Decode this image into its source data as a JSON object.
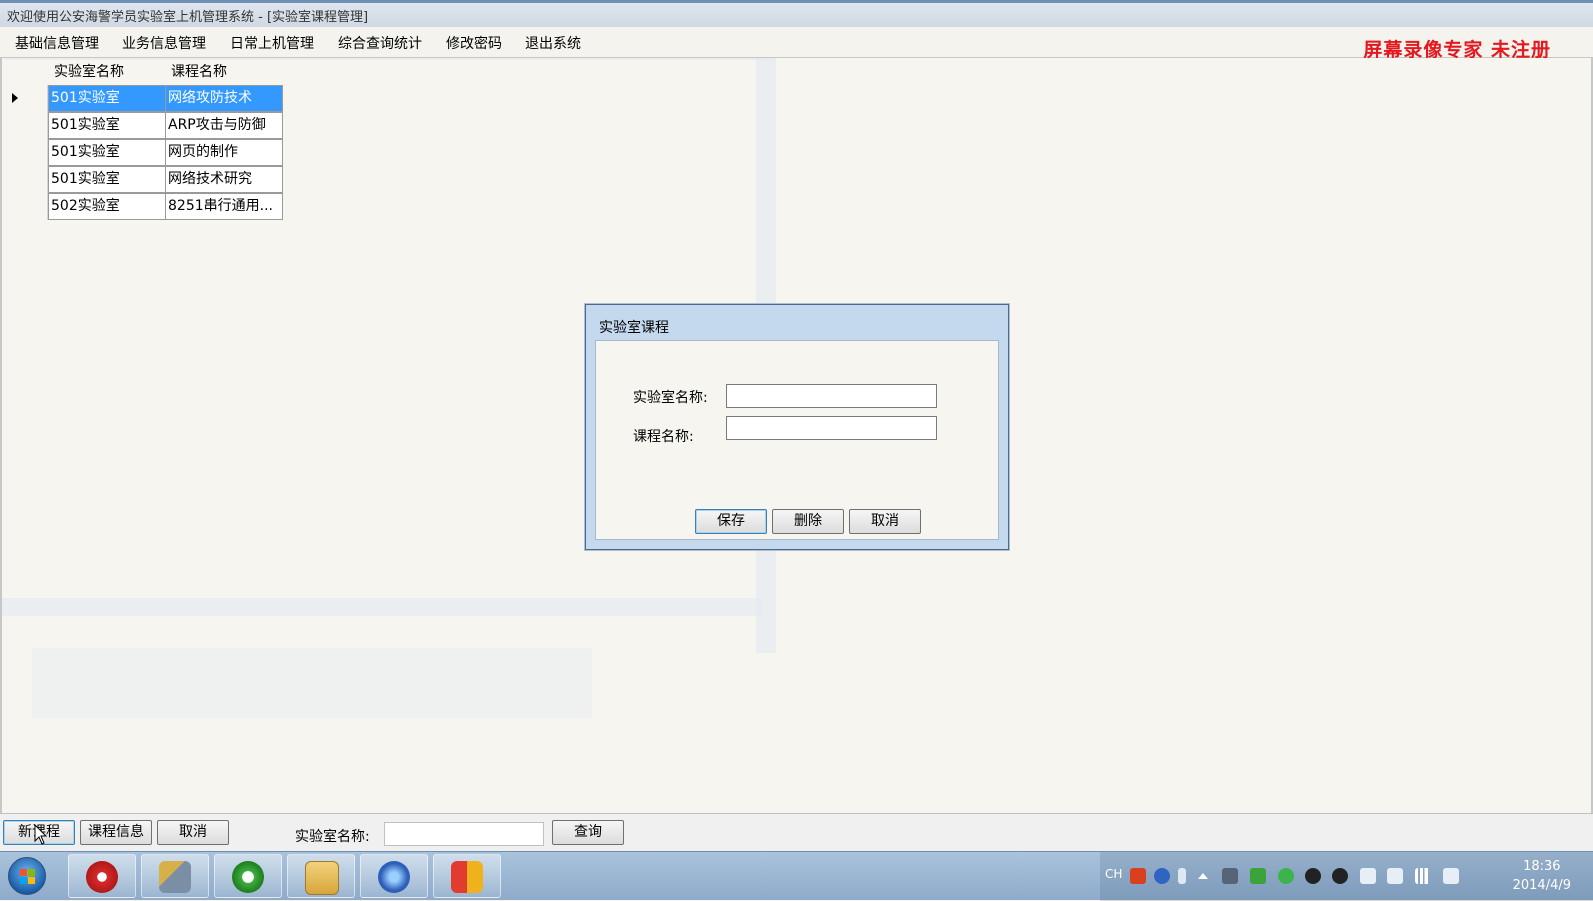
{
  "window": {
    "title": "欢迎使用公安海警学员实验室上机管理系统 - [实验室课程管理]"
  },
  "menu": {
    "items": [
      "基础信息管理",
      "业务信息管理",
      "日常上机管理",
      "综合查询统计",
      "修改密码",
      "退出系统"
    ],
    "watermark": "屏幕录像专家  未注册"
  },
  "grid": {
    "columns": [
      "实验室名称",
      "课程名称"
    ],
    "rows": [
      {
        "lab": "501实验室",
        "course": "网络攻防技术",
        "selected": true
      },
      {
        "lab": "501实验室",
        "course": "ARP攻击与防御",
        "selected": false
      },
      {
        "lab": "501实验室",
        "course": "网页的制作",
        "selected": false
      },
      {
        "lab": "501实验室",
        "course": "网络技术研究",
        "selected": false
      },
      {
        "lab": "502实验室",
        "course": "8251串行通用...",
        "selected": false
      }
    ]
  },
  "dialog": {
    "title": "实验室课程",
    "lab_label": "实验室名称:",
    "course_label": "课程名称:",
    "lab_value": "",
    "course_value": "",
    "buttons": {
      "save": "保存",
      "delete": "删除",
      "cancel": "取消"
    }
  },
  "toolbar": {
    "new_course": "新课程",
    "course_info": "课程信息",
    "cancel": "取消",
    "search_label": "实验室名称:",
    "search_value": "",
    "query": "查询"
  },
  "taskbar": {
    "apps": [
      "app-red-icon",
      "tools-icon",
      "ie-icon",
      "explorer-icon",
      "link-icon",
      "paint-icon"
    ],
    "tray": {
      "lang": "CH",
      "time": "18:36",
      "date": "2014/4/9"
    }
  }
}
